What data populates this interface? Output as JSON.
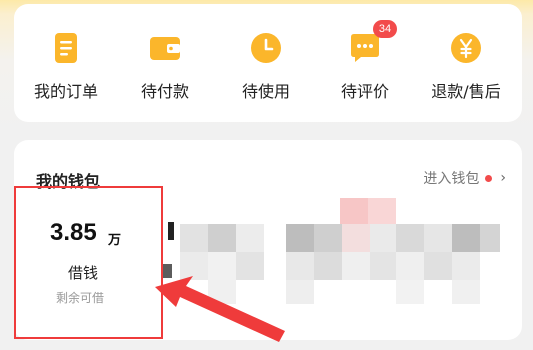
{
  "orders": {
    "items": [
      {
        "label": "我的订单",
        "icon": "order-list-icon"
      },
      {
        "label": "待付款",
        "icon": "wallet-icon"
      },
      {
        "label": "待使用",
        "icon": "clock-icon"
      },
      {
        "label": "待评价",
        "icon": "chat-bubble-icon",
        "badge": "34"
      },
      {
        "label": "退款/售后",
        "icon": "yuan-refund-icon"
      }
    ]
  },
  "wallet": {
    "title": "我的钱包",
    "link_label": "进入钱包",
    "link_chevron": "›"
  },
  "loan": {
    "amount": "3.85",
    "unit": "万",
    "label": "借钱",
    "sublabel": "剩余可借"
  },
  "colors": {
    "accent": "#fbb62b",
    "badge": "#f24b4b",
    "highlight": "#ef3b3b"
  }
}
